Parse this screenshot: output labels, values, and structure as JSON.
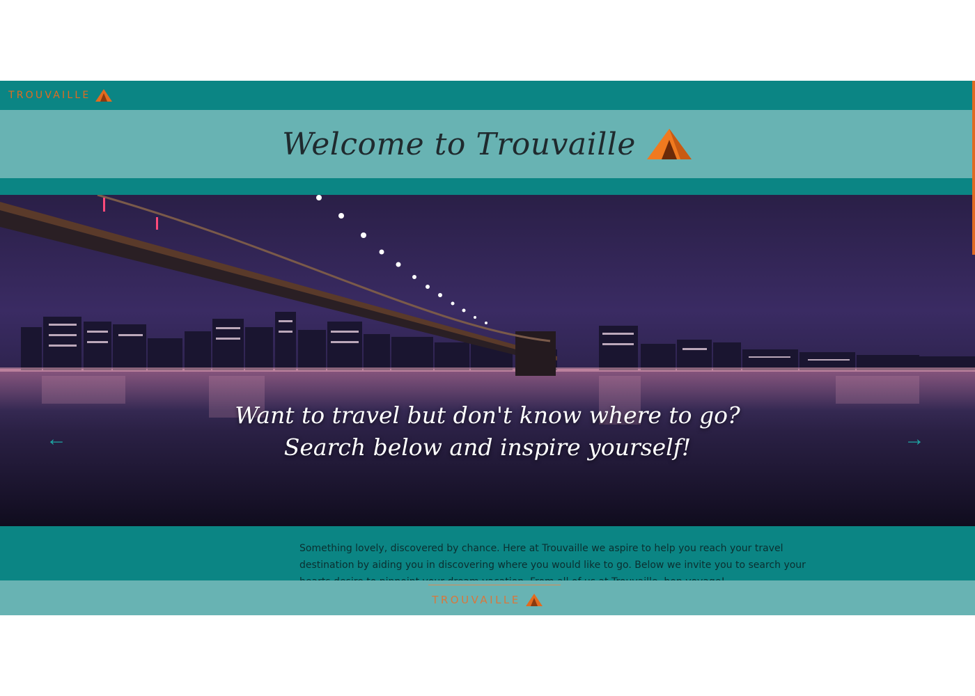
{
  "header": {
    "brand": "TROUVAILLE",
    "welcome_title": "Welcome to Trouvaille"
  },
  "hero": {
    "caption_line1": "Want to travel but don't know where to go?",
    "caption_line2": "Search below and inspire yourself!",
    "prev_icon": "arrow-left-icon",
    "next_icon": "arrow-right-icon"
  },
  "intro": {
    "text": "Something lovely, discovered by chance. Here at Trouvaille we aspire to help you reach your travel destination by aiding you in discovering where you would like to go. Below we invite you to search your hearts desire to pinpoint your dream vacation. From all of us at Trouvaille, bon voyage!"
  },
  "footer": {
    "brand": "TROUVAILLE"
  },
  "colors": {
    "teal_dark": "#0b8584",
    "teal_light": "#68b3b3",
    "accent_orange": "#e26b1f"
  }
}
